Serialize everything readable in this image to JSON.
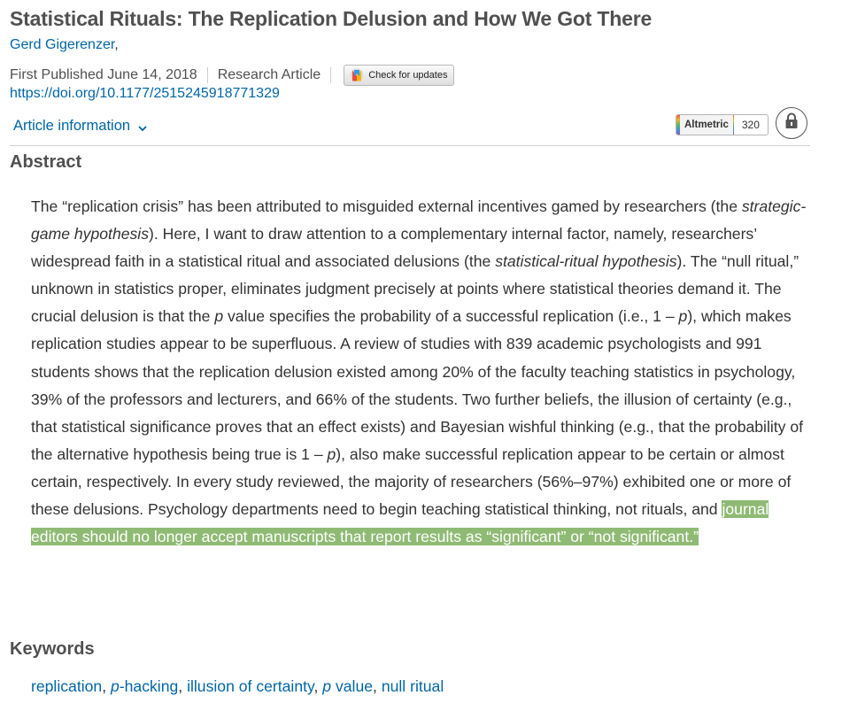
{
  "article": {
    "title": "Statistical Rituals: The Replication Delusion and How We Got There",
    "author": "Gerd Gigerenzer",
    "author_suffix": ",",
    "published": "First Published June 14, 2018",
    "type": "Research Article",
    "check_updates_label": "Check for updates",
    "doi": "https://doi.org/10.1177/2515245918771329",
    "article_info_label": "Article information",
    "altmetric_label": "Altmetric",
    "altmetric_score": "320"
  },
  "abstract": {
    "heading": "Abstract",
    "p1": "The “replication crisis” has been attributed to misguided external incentives gamed by researchers (the ",
    "p1_italic": "strategic-game hypothesis",
    "p2": "). Here, I want to draw attention to a complementary internal factor, namely, researchers’ widespread faith in a statistical ritual and associated delusions (the ",
    "p2_italic": "statistical-ritual hypothesis",
    "p3": "). The “null ritual,” unknown in statistics proper, eliminates judgment precisely at points where statistical theories demand it. The crucial delusion is that the ",
    "p_letter": "p",
    "p4": " value specifies the probability of a successful replication (i.e., 1 – ",
    "p5": "), which makes replication studies appear to be superfluous. A review of studies with 839 academic psychologists and 991 students shows that the replication delusion existed among 20% of the faculty teaching statistics in psychology, 39% of the professors and lecturers, and 66% of the students. Two further beliefs, the illusion of certainty (e.g., that statistical significance proves that an effect exists) and Bayesian wishful thinking (e.g., that the probability of the alternative hypothesis being true is 1 – ",
    "p6": "), also make successful replication appear to be certain or almost certain, respectively. In every study reviewed, the majority of researchers (56%–97%) exhibited one or more of these delusions. Psychology departments need to begin teaching statistical thinking, not rituals, and ",
    "highlight": "journal editors should no longer accept manuscripts that report results as “significant” or “not significant.”",
    "highlight_color": "#8fba74"
  },
  "keywords": {
    "heading": "Keywords",
    "items": [
      "replication",
      "-hacking",
      "illusion of certainty",
      " value",
      "null ritual"
    ],
    "p_letter": "p",
    "separator": ", "
  },
  "colors": {
    "link": "#0066a6",
    "heading": "#505050",
    "text": "#333333"
  },
  "icons": {
    "check_updates": "crossmark-icon",
    "article_info": "chevron-down-icon",
    "access": "lock-icon"
  }
}
